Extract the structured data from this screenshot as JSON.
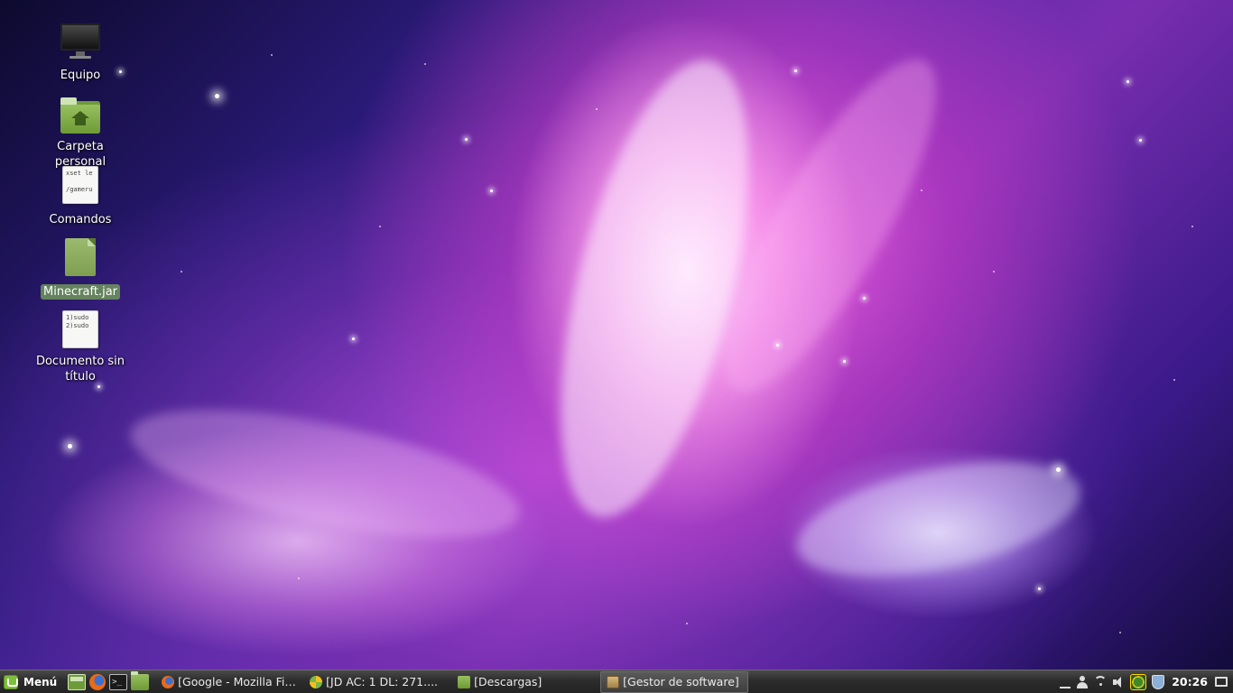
{
  "desktop": {
    "icons": [
      {
        "label": "Equipo",
        "icon": "computer-icon"
      },
      {
        "label": "Carpeta personal",
        "icon": "home-folder-icon"
      },
      {
        "label": "Comandos",
        "icon": "text-file-icon",
        "preview": "xset le\n\n/gameru"
      },
      {
        "label": "Minecraft.jar",
        "icon": "jar-file-icon",
        "selected": true
      },
      {
        "label": "Documento sin título",
        "icon": "text-file-icon",
        "preview": "1)sudo\n2)sudo"
      }
    ]
  },
  "taskbar": {
    "menu_label": "Menú",
    "launchers": [
      "show-desktop-icon",
      "firefox-icon",
      "terminal-icon",
      "files-icon"
    ],
    "tasks": [
      {
        "label": "[Google - Mozilla Fir...",
        "icon": "firefox-icon"
      },
      {
        "label": "[JD AC: 1 DL: 271....",
        "icon": "jdownloader-icon"
      },
      {
        "label": "[Descargas]",
        "icon": "folder-icon"
      },
      {
        "label": "[Gestor de software]",
        "icon": "software-manager-icon",
        "active": true
      }
    ],
    "tray": {
      "clock": "20:26",
      "icons": [
        "show-desktop-icon",
        "user-icon",
        "network-icon",
        "volume-icon",
        "update-manager-icon",
        "shield-icon",
        "workspace-icon"
      ]
    }
  },
  "colors": {
    "taskbar_bg": "#2c2c2c",
    "selection_bg": "#6e965a",
    "accent_green": "#7cbf3a"
  }
}
